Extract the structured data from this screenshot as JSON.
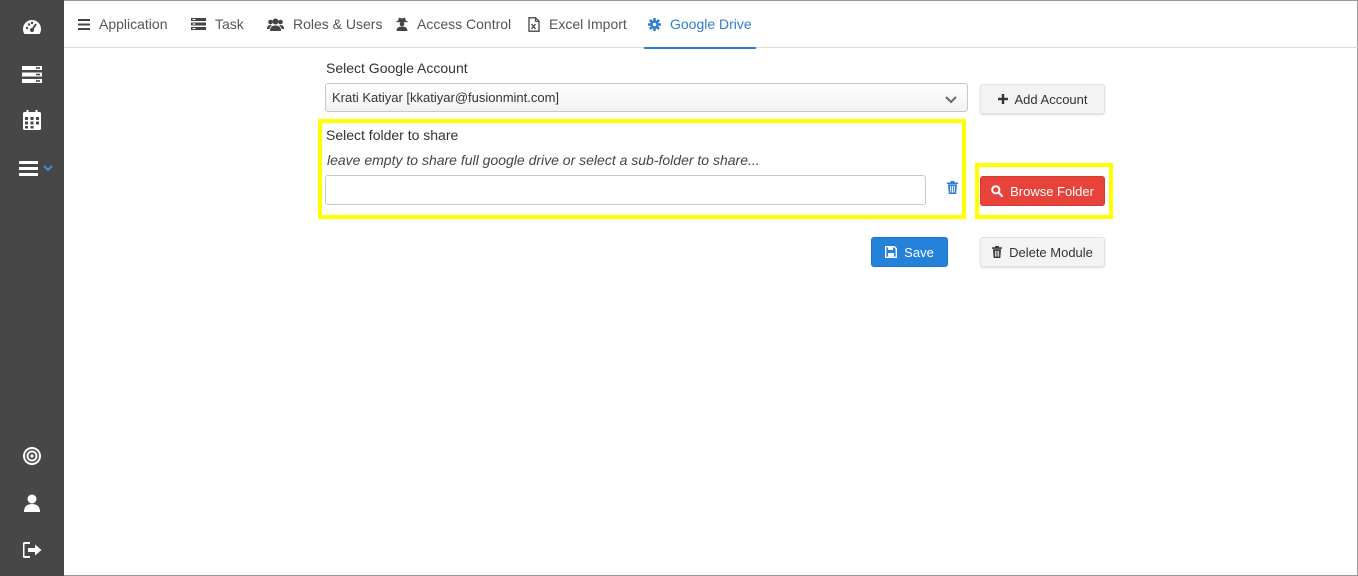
{
  "sidebar": {
    "items": [
      {
        "icon": "dashboard-icon"
      },
      {
        "icon": "server-icon"
      },
      {
        "icon": "calendar-icon"
      },
      {
        "icon": "menu-icon"
      },
      {
        "icon": "target-icon"
      },
      {
        "icon": "user-icon"
      },
      {
        "icon": "sign-out-icon"
      }
    ]
  },
  "tabs": [
    {
      "label": "Application",
      "icon": "list-icon"
    },
    {
      "label": "Task",
      "icon": "tasks-icon"
    },
    {
      "label": "Roles & Users",
      "icon": "users-icon"
    },
    {
      "label": "Access Control",
      "icon": "user-secret-icon"
    },
    {
      "label": "Excel Import",
      "icon": "excel-file-icon"
    },
    {
      "label": "Google Drive",
      "icon": "gear-icon",
      "active": true
    }
  ],
  "form": {
    "account_label": "Select Google Account",
    "account_value": "Krati Katiyar [kkatiyar@fusionmint.com]",
    "add_account_label": "Add Account",
    "folder_label": "Select folder to share",
    "folder_hint": "leave empty to share full google drive or select a sub-folder to share...",
    "folder_value": "",
    "browse_label": "Browse Folder",
    "save_label": "Save",
    "delete_label": "Delete Module"
  },
  "colors": {
    "sidebar_bg": "#474747",
    "accent": "#2f7fd0",
    "browse_button": "#e8433a",
    "save_button": "#2582db",
    "highlight": "#ffff00"
  }
}
